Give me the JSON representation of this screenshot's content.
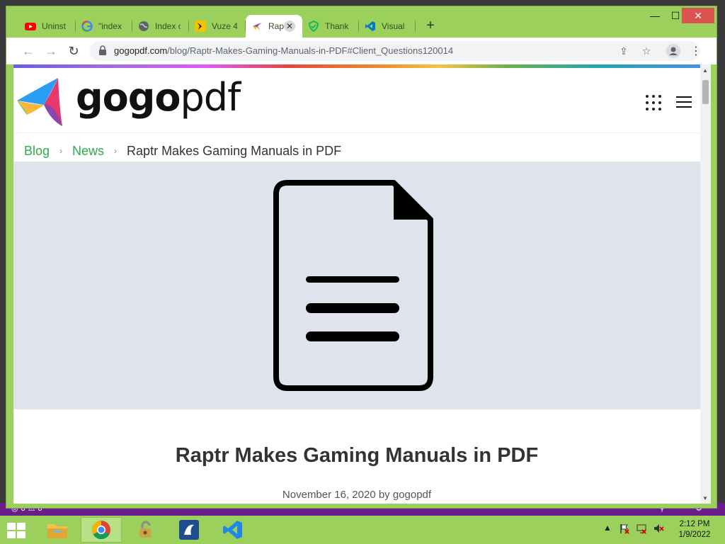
{
  "browser": {
    "tabs": [
      {
        "label": "Uninst",
        "favicon": "youtube-icon",
        "color": "#ff0000"
      },
      {
        "label": "\"index",
        "favicon": "google-icon",
        "color": "#4285f4"
      },
      {
        "label": "Index o",
        "favicon": "globe-icon",
        "color": "#5f6368"
      },
      {
        "label": "Vuze 4",
        "favicon": "vuze-icon",
        "color": "#f5c400"
      },
      {
        "label": "Rap",
        "favicon": "gogopdf-icon",
        "color": "#8e44ad",
        "active": true
      },
      {
        "label": "Thank",
        "favicon": "shield-icon",
        "color": "#1bb954"
      },
      {
        "label": "Visual",
        "favicon": "vscode-icon",
        "color": "#007acc"
      }
    ],
    "new_tab_symbol": "+",
    "window_controls": {
      "minimize": "—",
      "maximize": "☐",
      "close": "✕"
    },
    "address": {
      "host": "gogopdf.com",
      "path": "/blog/Raptr-Makes-Gaming-Manuals-in-PDF#Client_Questions120014"
    }
  },
  "site": {
    "logo": {
      "bold": "gogo",
      "light": "pdf"
    },
    "breadcrumb": {
      "items": [
        "Blog",
        "News"
      ],
      "current": "Raptr Makes Gaming Manuals in PDF",
      "separator": "›"
    },
    "article": {
      "title": "Raptr Makes Gaming Manuals in PDF",
      "meta": "November 16, 2020 by gogopdf"
    }
  },
  "taskbar": {
    "clock": {
      "time": "2:12 PM",
      "date": "1/9/2022"
    },
    "apps": [
      "file-explorer-icon",
      "chrome-icon",
      "lock-app-icon",
      "vuze-app-icon",
      "vscode-app-icon"
    ]
  },
  "colors": {
    "chrome_frame": "#9bd05d",
    "link_green": "#2eaa4c",
    "hero_bg": "#dfe4ec",
    "taskbar": "#9bd05d",
    "purple_strip": "#6b1d8c"
  }
}
